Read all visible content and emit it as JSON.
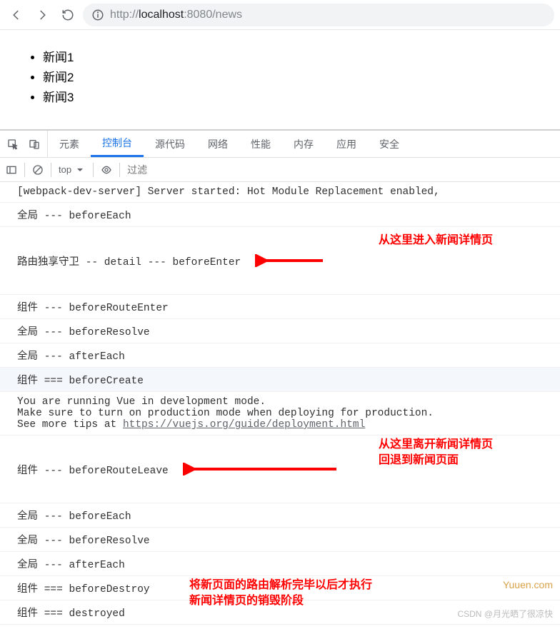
{
  "toolbar": {
    "url_host": "localhost",
    "url_port": ":8080",
    "url_path": "/news",
    "url_protocol": "http://"
  },
  "page": {
    "items": [
      "新闻1",
      "新闻2",
      "新闻3"
    ]
  },
  "devtools": {
    "tabs": [
      "元素",
      "控制台",
      "源代码",
      "网络",
      "性能",
      "内存",
      "应用",
      "安全"
    ],
    "active_tab": 1,
    "context": "top",
    "filter_placeholder": "过滤"
  },
  "console": {
    "lines": [
      "[webpack-dev-server] Server started: Hot Module Replacement enabled, ",
      "全局 --- beforeEach",
      "路由独享守卫 -- detail --- beforeEnter",
      "组件 --- beforeRouteEnter",
      "全局 --- beforeResolve",
      "全局 --- afterEach",
      "组件 === beforeCreate",
      "You are running Vue in development mode.\nMake sure to turn on production mode when deploying for production.\nSee more tips at ",
      "组件 --- beforeRouteLeave",
      "全局 --- beforeEach",
      "全局 --- beforeResolve",
      "全局 --- afterEach",
      "组件 === beforeDestroy",
      "组件 === destroyed"
    ],
    "link": "https://vuejs.org/guide/deployment.html"
  },
  "annotations": {
    "a1": "从这里进入新闻详情页",
    "a2": "从这里离开新闻详情页\n回退到新闻页面",
    "a3": "将新页面的路由解析完毕以后才执行\n新闻详情页的销毁阶段"
  },
  "watermark": "CSDN @月光晒了很凉快",
  "yuucn": "Yuuen.com"
}
